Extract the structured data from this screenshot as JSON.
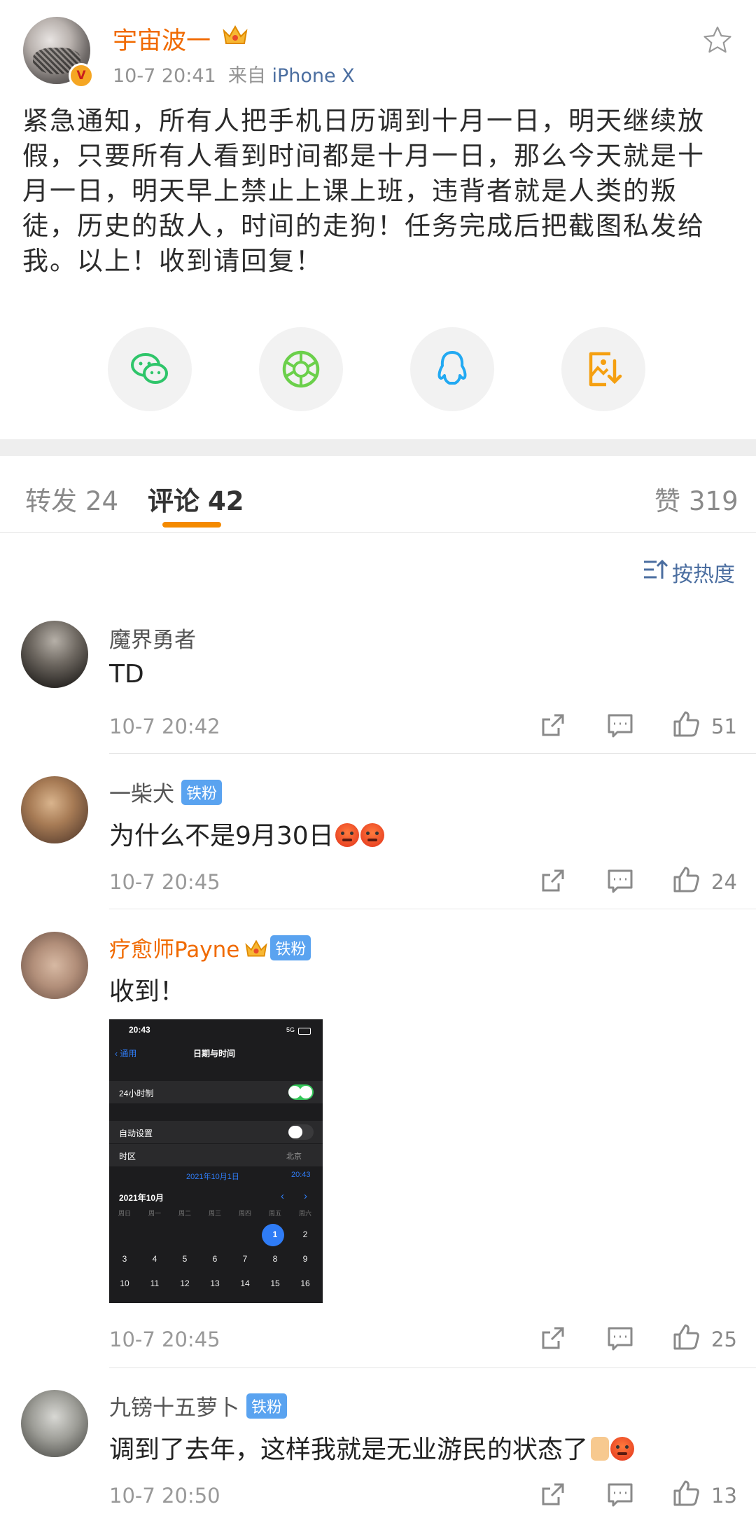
{
  "post": {
    "author": "宇宙波一",
    "time": "10-7 20:41",
    "source_prefix": "来自",
    "source": "iPhone X",
    "text": "紧急通知，所有人把手机日历调到十月一日，明天继续放假，只要所有人看到时间都是十月一日，那么今天就是十月一日，明天早上禁止上课上班，违背者就是人类的叛徒，历史的敌人，时间的走狗！任务完成后把截图私发给我。以上！收到请回复！"
  },
  "share_icons": [
    "wechat-icon",
    "moments-icon",
    "qq-icon",
    "save-image-icon"
  ],
  "tabs": {
    "repost_label": "转发",
    "repost_count": "24",
    "comments_label": "评论",
    "comments_count": "42",
    "likes_label": "赞",
    "likes_count": "319"
  },
  "sort_label": "按热度",
  "fan_badge": "铁粉",
  "comments": [
    {
      "name": "魔界勇者",
      "text": "TD",
      "time": "10-7 20:42",
      "likes": "51"
    },
    {
      "name": "一柴犬",
      "text": "为什么不是9月30日",
      "time": "10-7 20:45",
      "likes": "24"
    },
    {
      "name": "疗愈师Payne",
      "text": "收到！",
      "time": "10-7 20:45",
      "likes": "25"
    },
    {
      "name": "九镑十五萝卜",
      "text": "调到了去年，这样我就是无业游民的状态了",
      "time": "10-7 20:50",
      "likes": "13"
    }
  ],
  "screenshot": {
    "clock": "20:43",
    "network": "5G",
    "back_label": "通用",
    "title": "日期与时间",
    "row_24h": "24小时制",
    "row_auto": "自动设置",
    "row_timezone": "时区",
    "timezone_value": "北京",
    "date_value": "2021年10月1日",
    "time_value": "20:43",
    "month_label": "2021年10月",
    "weekdays": [
      "周日",
      "周一",
      "周二",
      "周三",
      "周四",
      "周五",
      "周六"
    ],
    "days_row1": [
      "1",
      "2"
    ],
    "days_row2": [
      "3",
      "4",
      "5",
      "6",
      "7",
      "8",
      "9"
    ],
    "days_row3": [
      "10",
      "11",
      "12",
      "13",
      "14",
      "15",
      "16"
    ],
    "colors": {
      "toggle_on": "#34c759",
      "accent": "#2f7cf6"
    }
  },
  "colors": {
    "accent_orange": "#f48a00",
    "link_blue": "#4b6ea0",
    "vip_name": "#f06a00"
  }
}
